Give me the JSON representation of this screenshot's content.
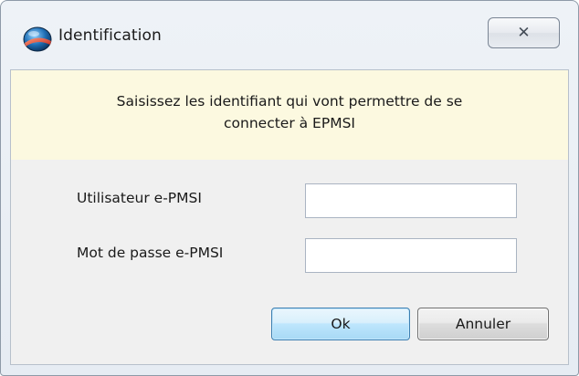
{
  "window": {
    "title": "Identification",
    "app_icon": "epmsi-app-icon",
    "close_glyph": "✕"
  },
  "banner": {
    "line1": "Saisissez les identifiant qui vont permettre de se",
    "line2": "connecter à EPMSI",
    "background": "#fcf9e0"
  },
  "form": {
    "username_label": "Utilisateur e-PMSI",
    "username_value": "",
    "password_label": "Mot de passe e-PMSI",
    "password_value": ""
  },
  "buttons": {
    "ok_label": "Ok",
    "cancel_label": "Annuler"
  },
  "colors": {
    "ok_border": "#3c7fb1",
    "dialog_bg": "#f0f0f0"
  }
}
